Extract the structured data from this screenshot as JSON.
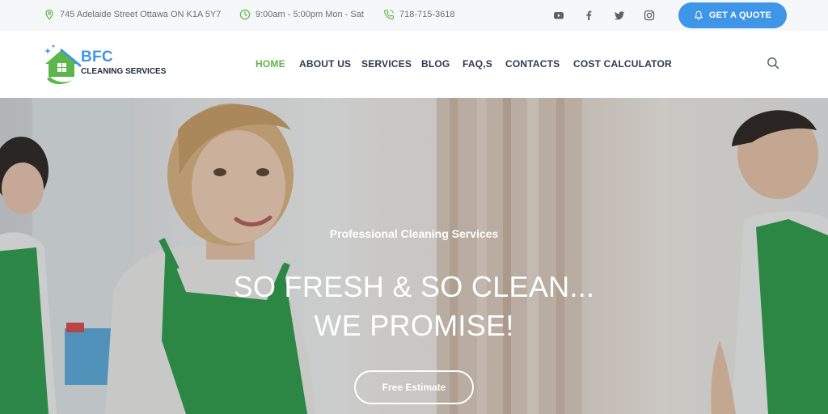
{
  "topbar": {
    "address": "745 Adelaide Street Ottawa ON K1A 5Y7",
    "hours": "9:00am - 5:00pm Mon - Sat",
    "phone": "718-715-3618",
    "social": [
      "youtube-icon",
      "facebook-icon",
      "twitter-icon",
      "instagram-icon"
    ],
    "quote_label": "GET A QUOTE"
  },
  "logo": {
    "brand": "BFC",
    "tagline": "CLEANING SERVICES"
  },
  "nav": {
    "items": [
      {
        "label": "HOME",
        "active": true
      },
      {
        "label": "ABOUT US",
        "active": false
      },
      {
        "label": "SERVICES",
        "active": false
      },
      {
        "label": "BLOG",
        "active": false
      },
      {
        "label": "FAQ,S",
        "active": false
      },
      {
        "label": "CONTACTS",
        "active": false
      },
      {
        "label": "COST CALCULATOR",
        "active": false
      }
    ]
  },
  "hero": {
    "subtitle": "Professional Cleaning Services",
    "title_line1": "SO FRESH & SO CLEAN...",
    "title_line2": "WE PROMISE!",
    "button_label": "Free Estimate"
  },
  "colors": {
    "accent_blue": "#3f96e8",
    "accent_green": "#5bb749",
    "nav_text": "#2b3a52",
    "apron_green": "#2e9a4a"
  }
}
